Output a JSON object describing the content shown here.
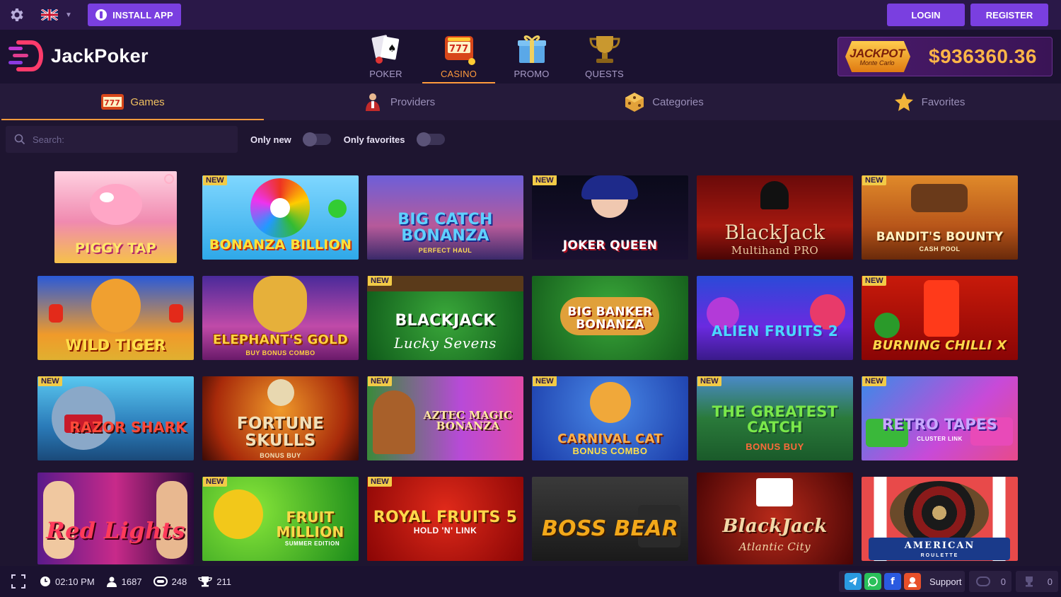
{
  "topbar": {
    "language": "English (UK)",
    "install_label": "INSTALL APP",
    "login_label": "LOGIN",
    "register_label": "REGISTER"
  },
  "header": {
    "logo_text": "JackPoker",
    "nav": [
      {
        "label": "POKER",
        "icon": "poker-cards-icon"
      },
      {
        "label": "CASINO",
        "icon": "slot-machine-icon",
        "active": true
      },
      {
        "label": "PROMO",
        "icon": "gift-icon"
      },
      {
        "label": "QUESTS",
        "icon": "trophy-icon"
      }
    ],
    "jackpot": {
      "title": "JACKPOT",
      "subtitle": "Monte Carlo",
      "amount": "$936360.36"
    }
  },
  "category_tabs": [
    {
      "label": "Games",
      "icon": "slot-777-icon",
      "active": true
    },
    {
      "label": "Providers",
      "icon": "dealer-icon"
    },
    {
      "label": "Categories",
      "icon": "dice-icon"
    },
    {
      "label": "Favorites",
      "icon": "star-icon"
    }
  ],
  "filters": {
    "search_placeholder": "Search:",
    "only_new_label": "Only new",
    "only_favorites_label": "Only favorites"
  },
  "games": [
    {
      "title": "PIGGY TAP",
      "new": false
    },
    {
      "title": "BONANZA BILLION",
      "new": true
    },
    {
      "title": "BIG CATCH BONANZA",
      "subtitle": "PERFECT HAUL",
      "new": false
    },
    {
      "title": "JOKER QUEEN",
      "new": true
    },
    {
      "title": "BlackJack",
      "subtitle": "Multihand PRO",
      "new": false
    },
    {
      "title": "BANDIT'S BOUNTY",
      "subtitle": "CASH POOL",
      "new": true
    },
    {
      "title": "WILD TIGER",
      "new": false
    },
    {
      "title": "ELEPHANT'S GOLD",
      "subtitle": "BUY BONUS COMBO",
      "new": false
    },
    {
      "title": "BLACKJACK",
      "subtitle": "Lucky Sevens",
      "new": true
    },
    {
      "title": "BIG BANKER BONANZA",
      "new": false
    },
    {
      "title": "ALIEN FRUITS 2",
      "new": false
    },
    {
      "title": "BURNING CHILLI X",
      "new": true
    },
    {
      "title": "RAZOR SHARK",
      "new": true
    },
    {
      "title": "FORTUNE SKULLS",
      "subtitle": "BONUS BUY",
      "new": false
    },
    {
      "title": "AZTEC MAGIC BONANZA",
      "new": true
    },
    {
      "title": "CARNIVAL CAT",
      "subtitle": "BONUS COMBO",
      "new": true
    },
    {
      "title": "THE GREATEST CATCH",
      "subtitle": "BONUS BUY",
      "new": true
    },
    {
      "title": "RETRO TAPES",
      "subtitle": "CLUSTER LINK",
      "new": true
    },
    {
      "title": "Red Lights",
      "new": false
    },
    {
      "title": "FRUIT MILLION",
      "subtitle": "SUMMER EDITION",
      "new": true
    },
    {
      "title": "ROYAL FRUITS 5",
      "subtitle": "HOLD 'N' LINK",
      "new": true
    },
    {
      "title": "BOSS BEAR",
      "new": false
    },
    {
      "title": "BlackJack",
      "subtitle": "Atlantic City",
      "new": false
    },
    {
      "title": "AMERICAN",
      "subtitle": "ROULETTE",
      "new": false
    }
  ],
  "new_badge_label": "NEW",
  "bottombar": {
    "time": "02:10 PM",
    "players": "1687",
    "tables": "248",
    "tournaments": "211",
    "support_label": "Support",
    "counter_1": "0",
    "counter_2": "0"
  },
  "colors": {
    "accent": "#7a3fe0",
    "active": "#ff9a3c",
    "background": "#1e1530",
    "jackpot_amount": "#ffb648",
    "new_badge": "#f2cb47"
  }
}
